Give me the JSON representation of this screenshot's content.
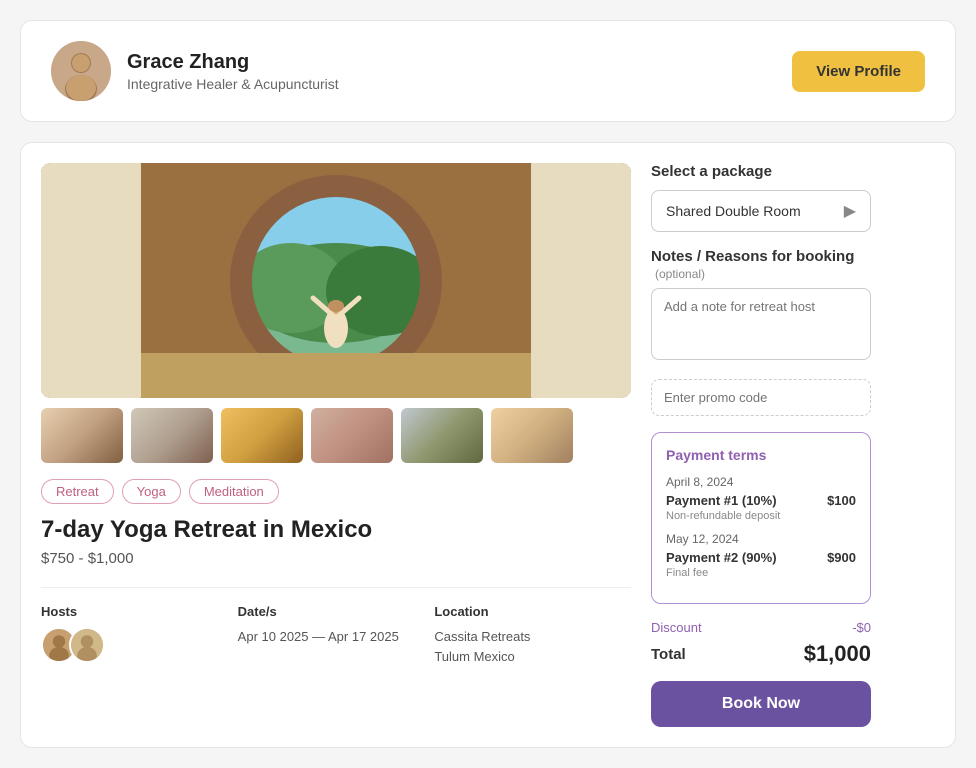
{
  "profile": {
    "name": "Grace Zhang",
    "title": "Integrative Healer & Acupuncturist",
    "view_profile_label": "View Profile"
  },
  "hero": {
    "alt": "Yoga retreat hero image"
  },
  "thumbnails": [
    {
      "label": "thumb-1"
    },
    {
      "label": "thumb-2"
    },
    {
      "label": "thumb-3"
    },
    {
      "label": "thumb-4"
    },
    {
      "label": "thumb-5"
    },
    {
      "label": "thumb-6"
    }
  ],
  "tags": [
    "Retreat",
    "Yoga",
    "Meditation"
  ],
  "retreat": {
    "title": "7-day Yoga Retreat in Mexico",
    "price_range": "$750 - $1,000"
  },
  "info": {
    "hosts_label": "Hosts",
    "dates_label": "Date/s",
    "dates_value": "Apr 10 2025 — Apr 17 2025",
    "location_label": "Location",
    "location_line1": "Cassita Retreats",
    "location_line2": "Tulum Mexico"
  },
  "booking": {
    "package_label": "Select a package",
    "package_value": "Shared Double Room",
    "notes_label": "Notes / Reasons for booking",
    "notes_optional": "(optional)",
    "notes_placeholder": "Add a note for retreat host",
    "promo_placeholder": "Enter promo code",
    "payment_terms_title": "Payment terms",
    "payment1_date": "April 8, 2024",
    "payment1_label": "Payment #1 (10%)",
    "payment1_amount": "$100",
    "payment1_sub": "Non-refundable deposit",
    "payment2_date": "May 12, 2024",
    "payment2_label": "Payment #2 (90%)",
    "payment2_amount": "$900",
    "payment2_sub": "Final fee",
    "discount_label": "Discount",
    "discount_value": "-$0",
    "total_label": "Total",
    "total_value": "$1,000",
    "book_label": "Book Now"
  }
}
